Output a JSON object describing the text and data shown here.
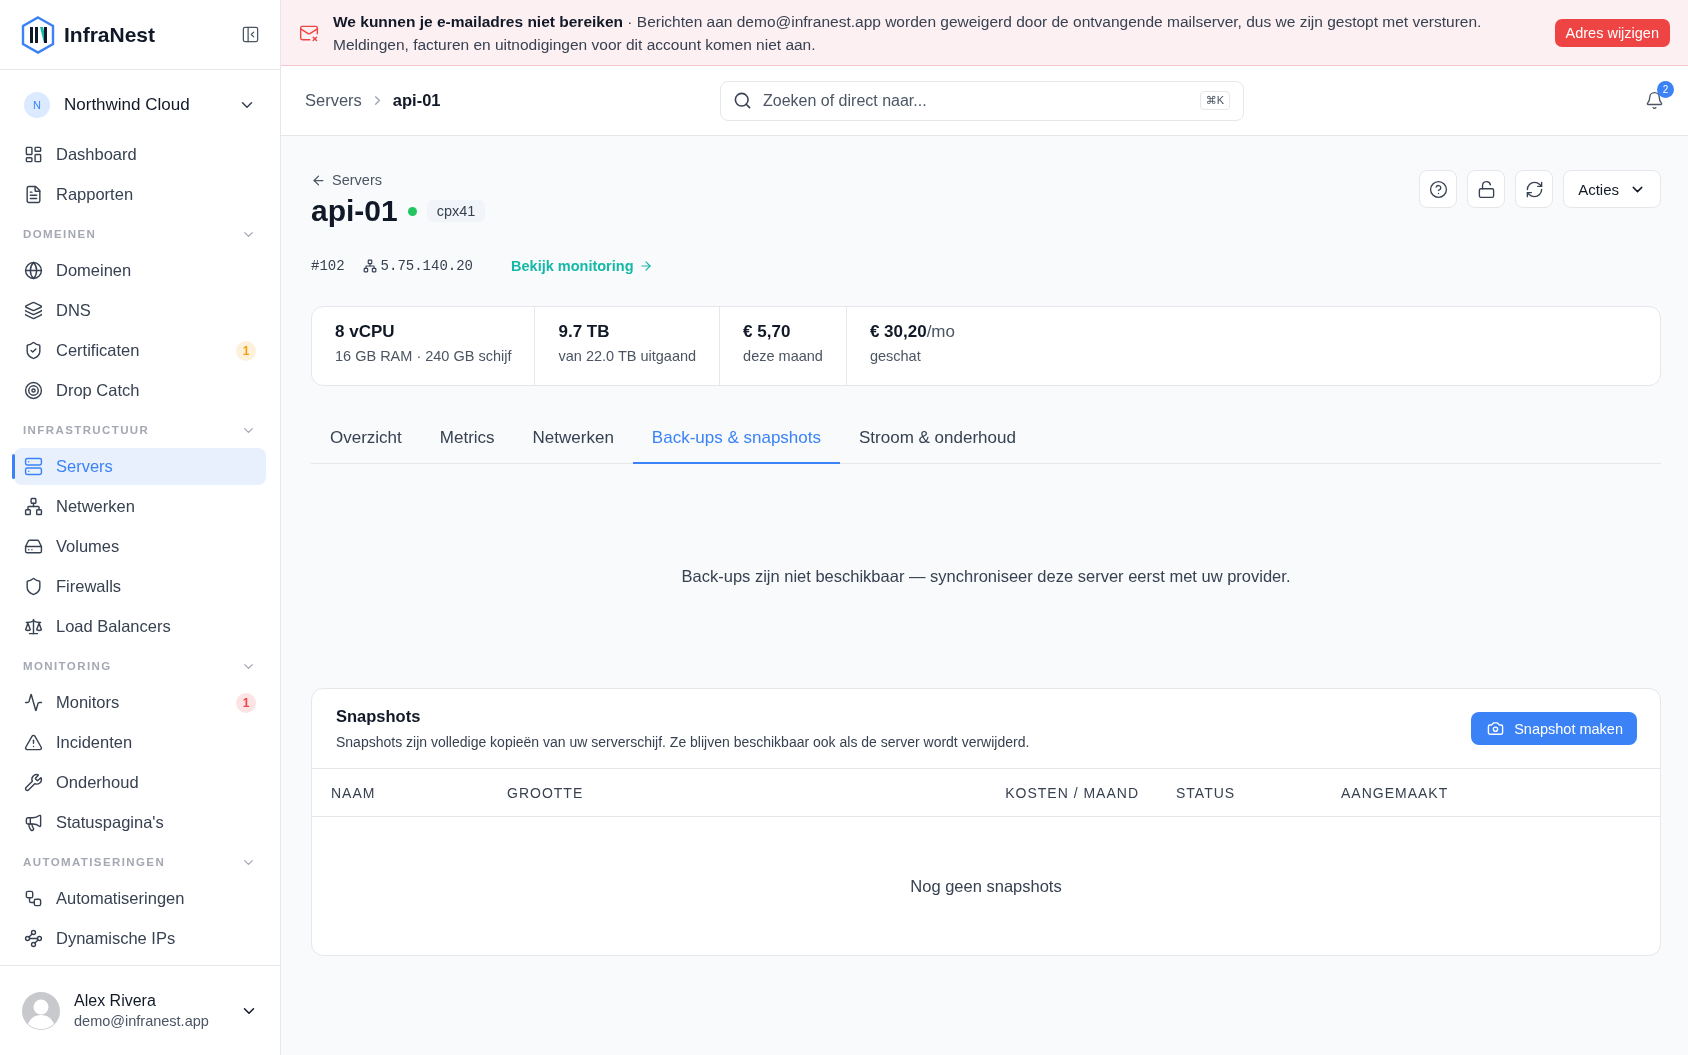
{
  "sidebar": {
    "brand": "InfraNest",
    "workspace": {
      "initial": "N",
      "name": "Northwind Cloud"
    },
    "items": [
      {
        "label": "Dashboard",
        "selected": false
      },
      {
        "label": "Rapporten",
        "selected": false
      }
    ],
    "sections": [
      {
        "title": "DOMEINEN",
        "expanded": true,
        "items": [
          {
            "label": "Domeinen",
            "selected": false
          },
          {
            "label": "DNS",
            "selected": false
          },
          {
            "label": "Certificaten",
            "selected": false,
            "badge": "1",
            "color": "#f59e0b"
          },
          {
            "label": "Drop Catch",
            "selected": false
          }
        ]
      },
      {
        "title": "INFRASTRUCTUUR",
        "expanded": true,
        "items": [
          {
            "label": "Servers",
            "selected": true
          },
          {
            "label": "Netwerken",
            "selected": false
          },
          {
            "label": "Volumes",
            "selected": false
          },
          {
            "label": "Firewalls",
            "selected": false
          },
          {
            "label": "Load Balancers",
            "selected": false
          }
        ]
      },
      {
        "title": "MONITORING",
        "expanded": true,
        "items": [
          {
            "label": "Monitors",
            "selected": false,
            "badge": "1",
            "color": "#ef4444"
          },
          {
            "label": "Incidenten",
            "selected": false
          },
          {
            "label": "Onderhoud",
            "selected": false
          },
          {
            "label": "Statuspagina's",
            "selected": false
          }
        ]
      },
      {
        "title": "AUTOMATISERINGEN",
        "expanded": true,
        "items": [
          {
            "label": "Automatiseringen",
            "selected": false
          },
          {
            "label": "Dynamische IPs",
            "selected": false
          }
        ]
      }
    ],
    "user": {
      "name": "Alex Rivera",
      "email": "demo@infranest.app"
    }
  },
  "banner": {
    "message": "**We kunnen je e-mailadres niet bereiken** · Berichten aan demo@infranest.app worden geweigerd door de ontvangende mailserver, dus we zijn gestopt met versturen. Meldingen, facturen en uitnodigingen voor dit account komen niet aan.",
    "action": "Adres wijzigen"
  },
  "header": {
    "breadcrumb": [
      "Servers",
      "api-01"
    ],
    "search": {
      "placeholder": "Zoeken of direct naar...",
      "shortcut": "⌘K"
    },
    "notifications": "2"
  },
  "server": {
    "back": "Servers",
    "name": "api-01",
    "online": true,
    "type": "cpx41",
    "id": "#102",
    "ip": "5.75.140.20",
    "link": "Bekijk monitoring",
    "actions": "Acties"
  },
  "stats": [
    {
      "value": "8 vCPU",
      "sub": "16 GB RAM · 240 GB schijf"
    },
    {
      "value": "9.7 TB",
      "sub": "van 22.0 TB uitgaand"
    },
    {
      "value": "€ 5,70",
      "sub": "deze maand"
    },
    {
      "value": "€ 30,20",
      "unit": "/mo",
      "sub": "geschat"
    }
  ],
  "tabs": [
    {
      "label": "Overzicht",
      "selected": false
    },
    {
      "label": "Metrics",
      "selected": false
    },
    {
      "label": "Netwerken",
      "selected": false
    },
    {
      "label": "Back-ups & snapshots",
      "selected": true
    },
    {
      "label": "Stroom & onderhoud",
      "selected": false
    }
  ],
  "notice": "Back-ups zijn niet beschikbaar — synchroniseer deze server eerst met uw provider.",
  "snapshots": {
    "title": "Snapshots",
    "description": "Snapshots zijn volledige kopieën van uw serverschijf. Ze blijven beschikbaar ook als de server wordt verwijderd.",
    "button": "Snapshot maken",
    "columns": [
      "NAAM",
      "GROOTTE",
      "KOSTEN / MAAND",
      "STATUS",
      "AANGEMAAKT"
    ],
    "empty": "Nog geen snapshots"
  }
}
